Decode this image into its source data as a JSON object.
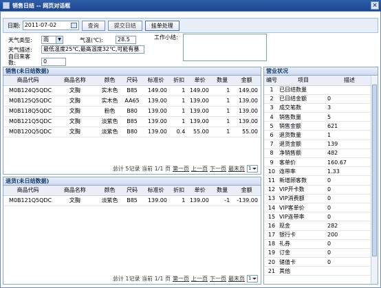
{
  "window": {
    "title": "销售日结 -- 网页对话框",
    "close_glyph": "×"
  },
  "toolbar": {
    "date_label": "日期:",
    "date_value": "2011-07-02",
    "query_label": "查询",
    "submit_label": "提交日结",
    "pending_label": "挂单处理"
  },
  "info": {
    "weather_type_label": "天气类型:",
    "weather_type_value": "雨",
    "temp_label": "气温(℃):",
    "temp_value": "28.5",
    "weather_desc_label": "天气描述:",
    "weather_desc_value": "最低温度25℃,最高温度32℃,可能有暴",
    "visitors_label_1": "自日来客",
    "visitors_label_2": "数:",
    "visitors_value": "0",
    "work_summary_label": "工作小结:"
  },
  "sales": {
    "title": "销售(未日结数据)",
    "headers": [
      "商品代码",
      "商品名称",
      "颜色",
      "尺码",
      "标准价",
      "折扣",
      "单价",
      "数量",
      "金额"
    ],
    "rows": [
      [
        "M0B124Q5QDC",
        "文胸",
        "实木色",
        "B85",
        "149.00",
        "1",
        "149.00",
        "1",
        "149.00"
      ],
      [
        "M0B125Q5QDC",
        "文胸",
        "实木色",
        "AA65",
        "139.00",
        "1",
        "139.00",
        "1",
        "139.00"
      ],
      [
        "M0B118Q5QDC",
        "文胸",
        "粉色",
        "B80",
        "139.00",
        "1",
        "139.00",
        "1",
        "139.00"
      ],
      [
        "M0B121Q5QDC",
        "文胸",
        "淡紫色",
        "B85",
        "139.00",
        "1",
        "139.00",
        "1",
        "139.00"
      ],
      [
        "M0B120Q5QDC",
        "文胸",
        "淡紫色",
        "B80",
        "139.00",
        "0.4",
        "55.00",
        "1",
        "55.00"
      ]
    ],
    "pager": {
      "summary": "总计 5记录 当前 1/1 页",
      "first": "第一页",
      "prev": "上一页",
      "next": "下一页",
      "last": "最末页",
      "page": "1"
    }
  },
  "returns": {
    "title": "退货(未日结数据)",
    "headers": [
      "商品代码",
      "商品名称",
      "颜色",
      "尺码",
      "标准价",
      "折扣",
      "单价",
      "数量",
      "金额"
    ],
    "rows": [
      [
        "M0B121Q5QDC",
        "文胸",
        "淡紫色",
        "B85",
        "139.00",
        "1",
        "139.00",
        "-1",
        "-139.00"
      ]
    ],
    "pager": {
      "summary": "总计 1记录 当前 1/1 页",
      "first": "第一页",
      "prev": "上一页",
      "next": "下一页",
      "last": "最末页",
      "page": "1"
    }
  },
  "business": {
    "title": "营业状况",
    "headers": [
      "编号",
      "项目",
      "描述"
    ],
    "rows": [
      [
        "1",
        "已日结数量",
        ""
      ],
      [
        "2",
        "已日结金额",
        "0"
      ],
      [
        "3",
        "成交笔数",
        "3"
      ],
      [
        "4",
        "销售数量",
        "5"
      ],
      [
        "5",
        "销售金额",
        "621"
      ],
      [
        "6",
        "退货数量",
        "1"
      ],
      [
        "7",
        "退货金额",
        "139"
      ],
      [
        "8",
        "净销售额",
        "482"
      ],
      [
        "9",
        "客单价",
        "160.67"
      ],
      [
        "10",
        "连带率",
        "1.33"
      ],
      [
        "11",
        "新增顾客数",
        "0"
      ],
      [
        "12",
        "VIP开卡数",
        "0"
      ],
      [
        "13",
        "VIP消费额",
        "0"
      ],
      [
        "14",
        "VIP客单价",
        "0"
      ],
      [
        "15",
        "VIP连带率",
        "0"
      ],
      [
        "16",
        "现金",
        "282"
      ],
      [
        "17",
        "银行卡",
        "200"
      ],
      [
        "18",
        "礼券",
        "0"
      ],
      [
        "19",
        "订金",
        "0"
      ],
      [
        "20",
        "储值卡",
        "0"
      ],
      [
        "21",
        "其他",
        ""
      ]
    ]
  },
  "colors": {
    "titlebar": "#1d4690",
    "panel_border": "#8aa6d1",
    "header_bg": "#e9eef7"
  }
}
